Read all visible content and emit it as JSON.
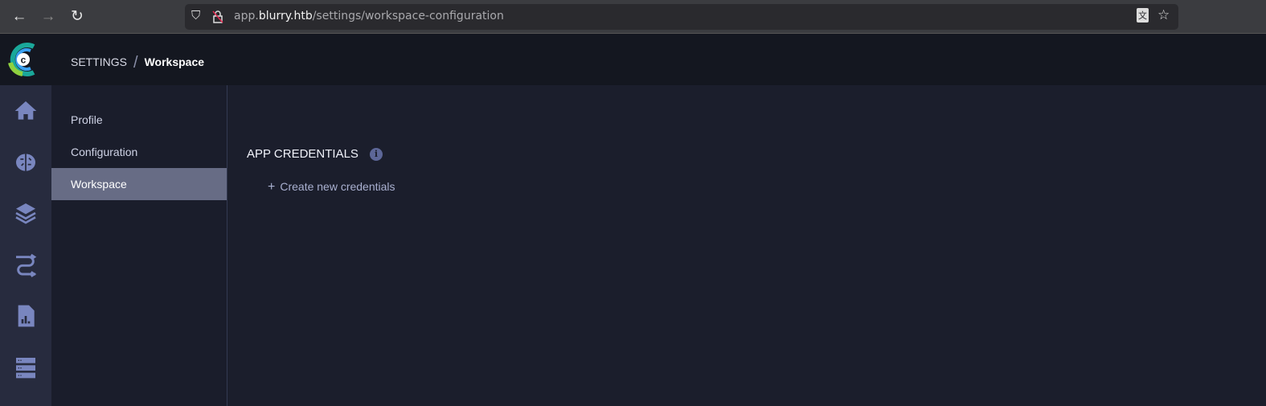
{
  "browser": {
    "url_host_prefix": "app.",
    "url_domain": "blurry.htb",
    "url_path": "/settings/workspace-configuration",
    "back": "←",
    "forward": "→",
    "reload": "↻",
    "shield": "⛉",
    "translate": "文",
    "star": "☆"
  },
  "header": {
    "section": "SETTINGS",
    "page": "Workspace"
  },
  "rail": {
    "icons": [
      "home-icon",
      "brain-icon",
      "layers-icon",
      "pipelines-icon",
      "reports-icon",
      "datastore-icon"
    ]
  },
  "subnav": {
    "items": [
      {
        "label": "Profile"
      },
      {
        "label": "Configuration"
      },
      {
        "label": "Workspace",
        "active": true
      }
    ]
  },
  "main": {
    "title": "APP CREDENTIALS",
    "info": "i",
    "create_plus": "+",
    "create_label": "Create new credentials"
  },
  "colors": {
    "accent": "#676c85",
    "icon": "#7986bf",
    "logo_teal": "#1aa89a",
    "logo_blue": "#3aa0f0",
    "logo_green": "#8fd13f"
  }
}
